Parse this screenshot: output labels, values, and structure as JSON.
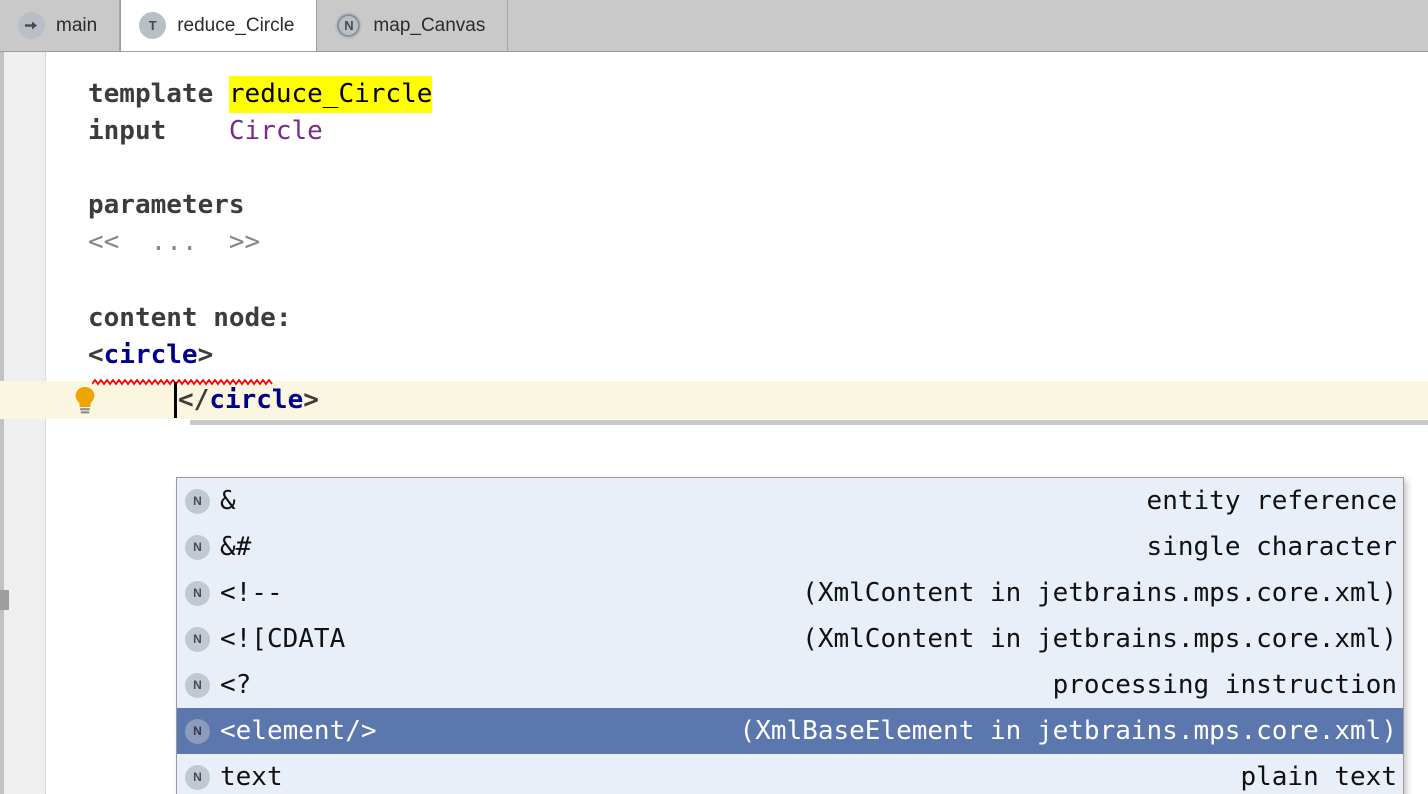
{
  "tabs": [
    {
      "label": "main",
      "icon": "arrow-right-circle-icon",
      "glyph": "",
      "active": false
    },
    {
      "label": "reduce_Circle",
      "icon": "template-node-icon",
      "glyph": "T",
      "active": true
    },
    {
      "label": "map_Canvas",
      "icon": "mapping-node-icon",
      "glyph": "N",
      "active": false
    }
  ],
  "editor": {
    "lines": {
      "l1_keyword": "template",
      "l1_name": "reduce_Circle",
      "l2_keyword": "input",
      "l2_value": "Circle",
      "l3_keyword": "parameters",
      "l4_placeholder": "<<  ...  >>",
      "l5_keyword": "content node:",
      "l6_open_lt": "<",
      "l6_open_name": "circle",
      "l6_open_gt": ">",
      "l7_close_lt": "</",
      "l7_close_name": "circle",
      "l7_close_gt": ">"
    },
    "intention_icon": "lightbulb-icon",
    "error_marker": "red-squiggly-underline",
    "caret": "text-caret",
    "highlight_color": "#ffff00",
    "current_line_color": "#faf6e0",
    "tag_color": "#00008b",
    "input_type_color": "#7a2a8f"
  },
  "completion_popup": {
    "items": [
      {
        "icon": "node-icon",
        "glyph": "N",
        "main": "&",
        "right": "entity reference",
        "selected": false
      },
      {
        "icon": "node-icon",
        "glyph": "N",
        "main": "&#",
        "right": "single character",
        "selected": false
      },
      {
        "icon": "node-icon",
        "glyph": "N",
        "main": "<!--",
        "right": "(XmlContent in jetbrains.mps.core.xml)",
        "selected": false
      },
      {
        "icon": "node-icon",
        "glyph": "N",
        "main": "<![CDATA",
        "right": "(XmlContent in jetbrains.mps.core.xml)",
        "selected": false
      },
      {
        "icon": "node-icon",
        "glyph": "N",
        "main": "<?",
        "right": "processing instruction",
        "selected": false
      },
      {
        "icon": "node-icon",
        "glyph": "N",
        "main": "<element/>",
        "right": "(XmlBaseElement in jetbrains.mps.core.xml)",
        "selected": true
      },
      {
        "icon": "node-icon",
        "glyph": "N",
        "main": "text",
        "right": "plain text",
        "selected": false
      }
    ],
    "selection_color": "#5b77ad",
    "background_color": "#e9eff9"
  }
}
